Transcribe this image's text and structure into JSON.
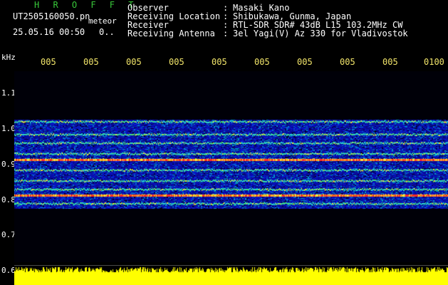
{
  "header": {
    "brand": "H R O F F T",
    "file_name": "UT2505160050.pn",
    "file_suffix": "meteor",
    "timestamp": "25.05.16 00:50",
    "timestamp_suffix": "0..",
    "observer_label": "Observer",
    "observer_value": "Masaki Kano",
    "location_label": "Receiving Location",
    "location_value": "Shibukawa, Gunma, Japan",
    "receiver_label": "Receiver",
    "receiver_value": "RTL-SDR SDR# 43dB L15 103.2MHz CW",
    "antenna_label": "Receiving Antenna",
    "antenna_value": "3el Yagi(V) Az 330 for Vladivostok",
    "separator": ":"
  },
  "axis": {
    "unit": "kHz",
    "x_ticks": [
      "005",
      "005",
      "005",
      "005",
      "005",
      "005",
      "005",
      "005",
      "005",
      "0100"
    ],
    "y_ticks": [
      "1.1",
      "1.0",
      "0.9",
      "0.8",
      "0.7",
      "0.6"
    ]
  },
  "spectrogram": {
    "background": "#000014",
    "noise_color": "#0a14a8",
    "signal_bands_khz": [
      1.02,
      0.985,
      0.96,
      0.93,
      0.915,
      0.885,
      0.855,
      0.83,
      0.815,
      0.79
    ],
    "strong_band_khz": [
      0.915,
      0.815
    ]
  },
  "level_bar": {
    "color": "#ffff00"
  }
}
